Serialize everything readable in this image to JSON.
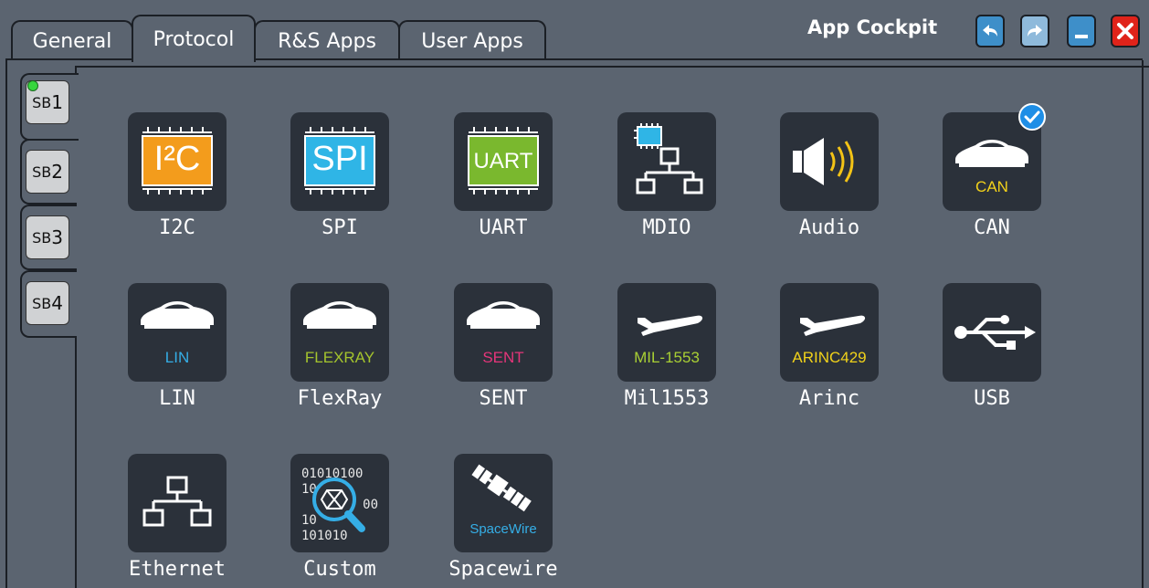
{
  "window": {
    "title": "App Cockpit",
    "undo_icon": "undo-arrow-icon",
    "redo_icon": "redo-arrow-icon",
    "minimize_icon": "minimize-icon",
    "close_icon": "close-x-icon"
  },
  "tabs": [
    {
      "label": "General",
      "active": false
    },
    {
      "label": "Protocol",
      "active": true
    },
    {
      "label": "R&S Apps",
      "active": false
    },
    {
      "label": "User Apps",
      "active": false
    }
  ],
  "side_tabs": [
    {
      "prefix": "SB",
      "num": "1",
      "active": true,
      "led": "green"
    },
    {
      "prefix": "SB",
      "num": "2",
      "active": false
    },
    {
      "prefix": "SB",
      "num": "3",
      "active": false
    },
    {
      "prefix": "SB",
      "num": "4",
      "active": false
    }
  ],
  "apps": [
    {
      "label": "I2C",
      "icon": "i2c-chip-icon",
      "chip_text": "I²C",
      "selected": false
    },
    {
      "label": "SPI",
      "icon": "spi-chip-icon",
      "chip_text": "SPI",
      "selected": false
    },
    {
      "label": "UART",
      "icon": "uart-chip-icon",
      "chip_text": "UART",
      "selected": false
    },
    {
      "label": "MDIO",
      "icon": "mdio-network-icon",
      "selected": false
    },
    {
      "label": "Audio",
      "icon": "speaker-icon",
      "selected": false
    },
    {
      "label": "CAN",
      "icon": "car-icon",
      "tile_text": "CAN",
      "selected": true
    },
    {
      "label": "LIN",
      "icon": "car-icon",
      "tile_text": "LIN",
      "selected": false
    },
    {
      "label": "FlexRay",
      "icon": "car-icon",
      "tile_text": "FLEXRAY",
      "selected": false
    },
    {
      "label": "SENT",
      "icon": "car-icon",
      "tile_text": "SENT",
      "selected": false
    },
    {
      "label": "Mil1553",
      "icon": "airplane-icon",
      "tile_text": "MIL-1553",
      "selected": false
    },
    {
      "label": "Arinc",
      "icon": "airplane-icon",
      "tile_text": "ARINC429",
      "selected": false
    },
    {
      "label": "USB",
      "icon": "usb-icon",
      "selected": false
    },
    {
      "label": "Ethernet",
      "icon": "ethernet-network-icon",
      "selected": false
    },
    {
      "label": "Custom",
      "icon": "custom-binary-magnifier-icon",
      "binary_lines": [
        "01010100",
        "10",
        "00",
        "10",
        "101010"
      ],
      "selected": false
    },
    {
      "label": "Spacewire",
      "icon": "satellite-icon",
      "tile_text": "SpaceWire",
      "selected": false
    }
  ],
  "colors": {
    "background": "#5b6470",
    "tile": "#2b313a",
    "i2c": "#f39c1c",
    "spi": "#2fb5e6",
    "uart": "#7ab82e",
    "audio_waves": "#f3c316",
    "can_text": "#f3d21a",
    "lin_text": "#35aee6",
    "flexray_text": "#a4c42d",
    "sent_text": "#e5357a",
    "mil_text": "#a9cf34",
    "arinc_text": "#f1d21a",
    "spacewire_text": "#35aee6",
    "check": "#1e8ee6"
  }
}
